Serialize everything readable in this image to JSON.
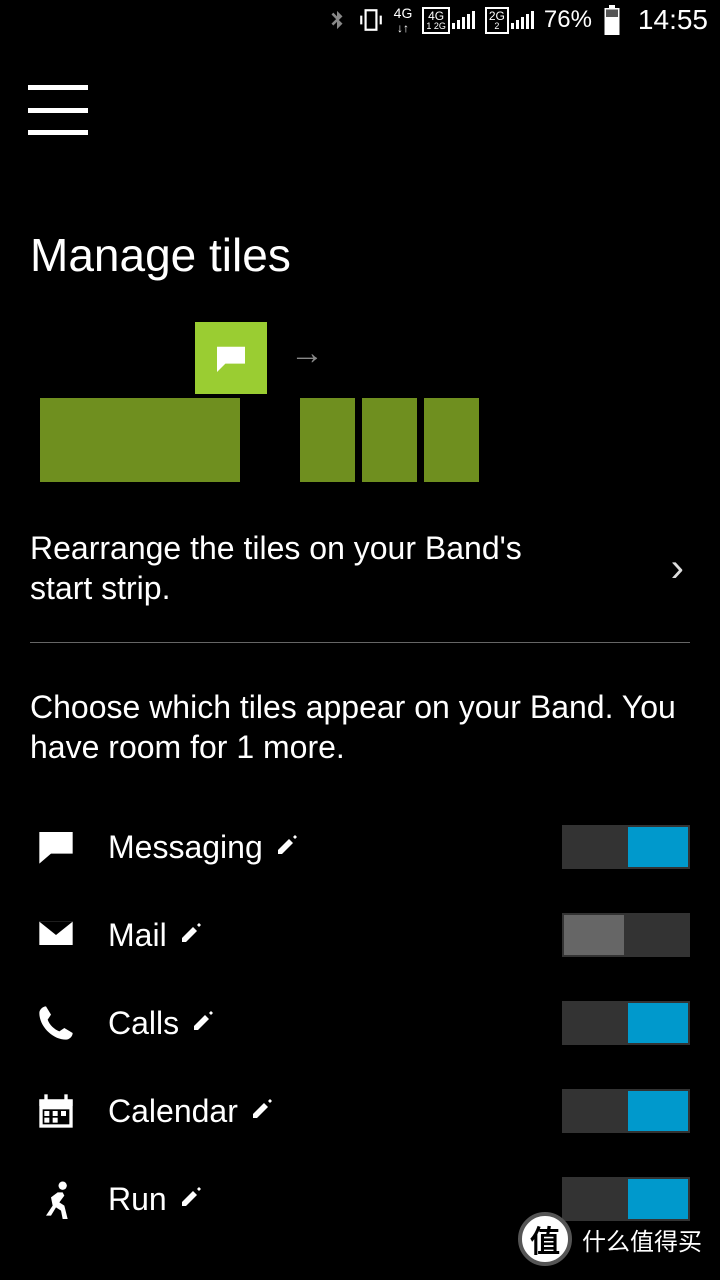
{
  "status": {
    "battery_pct": "76%",
    "clock": "14:55",
    "net1_top": "4G",
    "net1_arrows": "↓↑",
    "net2_top": "4G",
    "net2_sim": "1 2G",
    "net3_top": "2G",
    "net3_sim": "2"
  },
  "page": {
    "title": "Manage tiles",
    "rearrange_text": "Rearrange the tiles on your Band's start strip.",
    "choose_text": "Choose which tiles appear on your Band. You have room for 1 more."
  },
  "tiles": [
    {
      "id": "messaging",
      "label": "Messaging",
      "on": true,
      "editable": true
    },
    {
      "id": "mail",
      "label": "Mail",
      "on": false,
      "editable": true
    },
    {
      "id": "calls",
      "label": "Calls",
      "on": true,
      "editable": true
    },
    {
      "id": "calendar",
      "label": "Calendar",
      "on": true,
      "editable": true
    },
    {
      "id": "run",
      "label": "Run",
      "on": true,
      "editable": true
    }
  ],
  "watermark": {
    "badge": "值",
    "text": "什么值得买"
  },
  "colors": {
    "accent": "#0099cc",
    "tile_green": "#6f8f1f",
    "tile_green_light": "#9acd32"
  }
}
